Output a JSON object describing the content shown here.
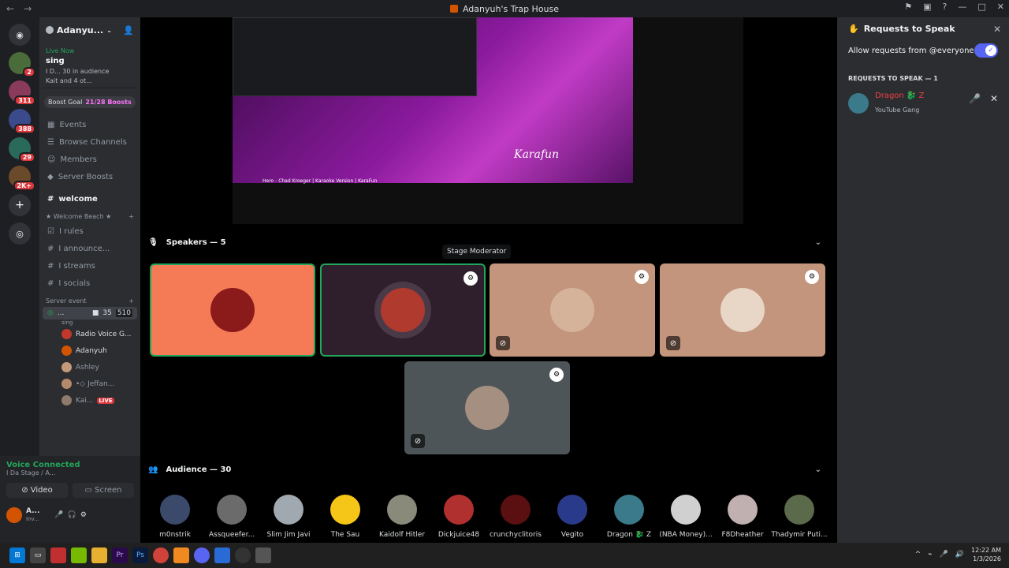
{
  "window": {
    "title": "Adanyuh's Trap House"
  },
  "servers": [
    {
      "badge": ""
    },
    {
      "badge": "2"
    },
    {
      "badge": "311"
    },
    {
      "badge": "388"
    },
    {
      "badge": "29"
    },
    {
      "badge": "2K+"
    }
  ],
  "guild": {
    "name": "Adanyu...",
    "live_now": "Live Now",
    "live_title": "sing",
    "live_line1": "I D...  30 in audience",
    "live_line2": "Kait  and 4 ot...",
    "boost_label": "Boost Goal",
    "boost_value": "21/28 Boosts"
  },
  "menu": [
    {
      "label": "Events"
    },
    {
      "label": "Browse Channels"
    },
    {
      "label": "Members"
    },
    {
      "label": "Server Boosts"
    }
  ],
  "welcome": "welcome",
  "category1": "★ Welcome Beach ★",
  "channels": [
    {
      "label": "I rules"
    },
    {
      "label": "I announce..."
    },
    {
      "label": "I streams"
    },
    {
      "label": "I socials"
    }
  ],
  "category2": "Server event",
  "stage": {
    "name": "...",
    "topic": "sing",
    "count1": "35",
    "count2": "510"
  },
  "stage_users": [
    {
      "name": "Radio Voice G...",
      "color": "#c0392b"
    },
    {
      "name": "Adanyuh",
      "color": "#d35400"
    },
    {
      "name": "Ashley",
      "color": "#c39b7b"
    },
    {
      "name": "•◇ Jeffan...",
      "color": "#b58a6a"
    },
    {
      "name": "Kai...",
      "color": "#8e7b6b",
      "live": "LIVE"
    }
  ],
  "voice": {
    "status": "Voice Connected",
    "sub": "I Da Stage / A...",
    "video": "Video",
    "screen": "Screen",
    "user": "A...",
    "user_sub": "Inv..."
  },
  "video": {
    "title": "Hero - Chad Kroeger | Karaoke Version | KaraFun",
    "brand": "Karafun"
  },
  "speakers_header": "Speakers — 5",
  "tooltip": "Stage Moderator",
  "speakers": [
    {
      "bg": "#f47b56",
      "av": "#8b1a1a"
    },
    {
      "bg": "#2f1f2d",
      "av": "#b03a2e"
    },
    {
      "bg": "#c3957c",
      "av": "#d5b39a"
    },
    {
      "bg": "#c3957c",
      "av": "#e8d6c7"
    },
    {
      "bg": "#4e5558",
      "av": "#a58f80"
    }
  ],
  "audience_header": "Audience — 30",
  "audience": [
    {
      "name": "m0nstrik",
      "color": "#3b4a6b"
    },
    {
      "name": "Assqueefer...",
      "color": "#6b6b6b"
    },
    {
      "name": "Slim Jim Javi",
      "color": "#a0a8b0"
    },
    {
      "name": "The Sau",
      "color": "#f5c518"
    },
    {
      "name": "Kaidolf Hitler",
      "color": "#8a8a7a"
    },
    {
      "name": "Dickjuice48",
      "color": "#b03030"
    },
    {
      "name": "crunchyclitoris",
      "color": "#5a1010"
    },
    {
      "name": "Vegito",
      "color": "#2a3a8a"
    },
    {
      "name": "Dragon 🐉 Z",
      "color": "#3a7a8a"
    },
    {
      "name": "(NBA Money)...",
      "color": "#d0d0d0"
    },
    {
      "name": "F8Dheather",
      "color": "#c0b0b0"
    },
    {
      "name": "Thadymir Puti...",
      "color": "#5a6a4a"
    }
  ],
  "requests": {
    "title": "Requests to Speak",
    "toggle": "Allow requests from @everyone",
    "section": "REQUESTS TO SPEAK — 1",
    "user": "Dragon 🐉 Z",
    "sub": "YouTube Gang"
  },
  "clock": {
    "time": "12:22 AM",
    "date": "1/3/2026"
  },
  "colors": {
    "accent": "#5865f2",
    "online": "#23a55a",
    "danger": "#da373c"
  }
}
